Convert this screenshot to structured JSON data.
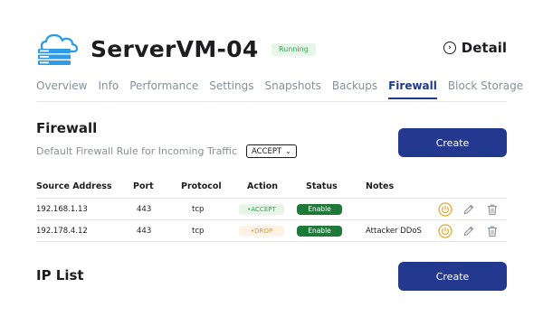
{
  "server": {
    "name": "ServerVM-04",
    "status": "Running"
  },
  "header": {
    "detail_label": "Detail"
  },
  "tabs": [
    {
      "label": "Overview",
      "active": false
    },
    {
      "label": "Info",
      "active": false
    },
    {
      "label": "Performance",
      "active": false
    },
    {
      "label": "Settings",
      "active": false
    },
    {
      "label": "Snapshots",
      "active": false
    },
    {
      "label": "Backups",
      "active": false
    },
    {
      "label": "Firewall",
      "active": true
    },
    {
      "label": "Block Storage",
      "active": false
    }
  ],
  "firewall": {
    "title": "Firewall",
    "default_rule_label": "Default Firewall Rule for Incoming Traffic",
    "default_rule_value": "ACCEPT",
    "create_label": "Create",
    "columns": [
      "Source Address",
      "Port",
      "Protocol",
      "Action",
      "Status",
      "Notes"
    ],
    "rows": [
      {
        "source": "192.168.1.13",
        "port": "443",
        "protocol": "tcp",
        "action": "•ACCEPT",
        "status": "Enable",
        "notes": ""
      },
      {
        "source": "192.178.4.12",
        "port": "443",
        "protocol": "tcp",
        "action": "•DROP",
        "status": "Enable",
        "notes": "Attacker DDoS"
      }
    ]
  },
  "ip_list": {
    "title": "IP List",
    "create_label": "Create"
  },
  "colors": {
    "accent": "#23388f",
    "running_bg": "#e6f7e9",
    "running_fg": "#2aa84a",
    "drop_fg": "#e59a2d",
    "enable_bg": "#1f7a3a",
    "power_icon": "#e0a92e"
  }
}
